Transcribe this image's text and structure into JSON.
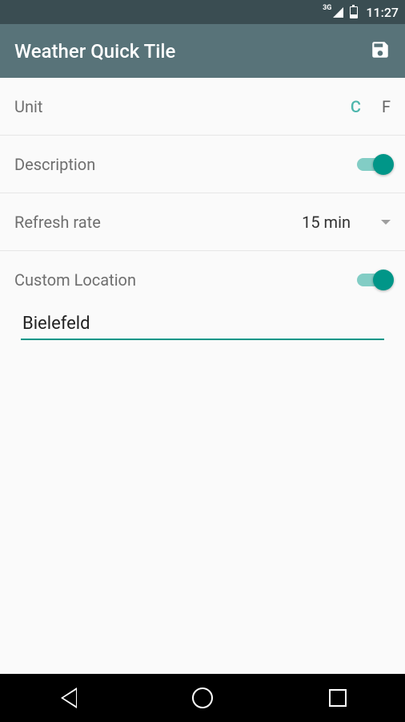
{
  "status": {
    "network": "3G",
    "time": "11:27"
  },
  "appBar": {
    "title": "Weather Quick Tile"
  },
  "settings": {
    "unit": {
      "label": "Unit",
      "option_c": "C",
      "option_f": "F",
      "selected": "C"
    },
    "description": {
      "label": "Description",
      "enabled": true
    },
    "refresh": {
      "label": "Refresh rate",
      "value": "15 min"
    },
    "customLocation": {
      "label": "Custom Location",
      "enabled": true,
      "value": "Bielefeld"
    }
  }
}
